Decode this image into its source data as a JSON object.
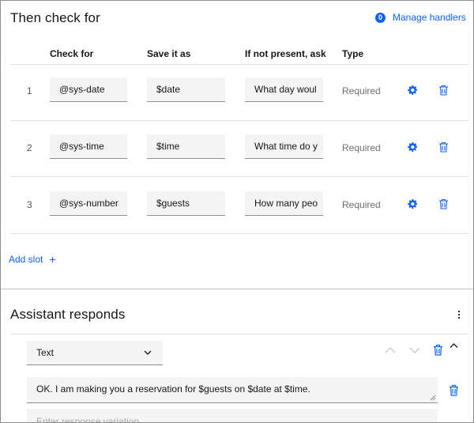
{
  "check_section": {
    "title": "Then check for",
    "handlers_count": "0",
    "manage_handlers_label": "Manage handlers",
    "columns": [
      "Check for",
      "Save it as",
      "If not present, ask",
      "Type"
    ],
    "slots": [
      {
        "num": "1",
        "check_for": "@sys-date",
        "save_as": "$date",
        "ask": "What day woul",
        "type": "Required"
      },
      {
        "num": "2",
        "check_for": "@sys-time",
        "save_as": "$time",
        "ask": "What time do y",
        "type": "Required"
      },
      {
        "num": "3",
        "check_for": "@sys-number",
        "save_as": "$guests",
        "ask": "How many peo",
        "type": "Required"
      }
    ],
    "add_slot_label": "Add slot",
    "add_slot_plus": "+"
  },
  "respond_section": {
    "title": "Assistant responds",
    "response_type": "Text",
    "response_text": "OK. I am making you a reservation for $guests on $date at $time.",
    "variation_placeholder": "Enter response variation"
  },
  "colors": {
    "accent": "#0f62fe",
    "field_bg": "#f4f4f4",
    "muted_text": "#6f6f6f"
  },
  "icons": [
    "settings-icon",
    "trash-icon",
    "overflow-menu-icon",
    "chevron-down-icon",
    "arrow-up-icon",
    "arrow-down-icon",
    "chevron-up-icon"
  ]
}
